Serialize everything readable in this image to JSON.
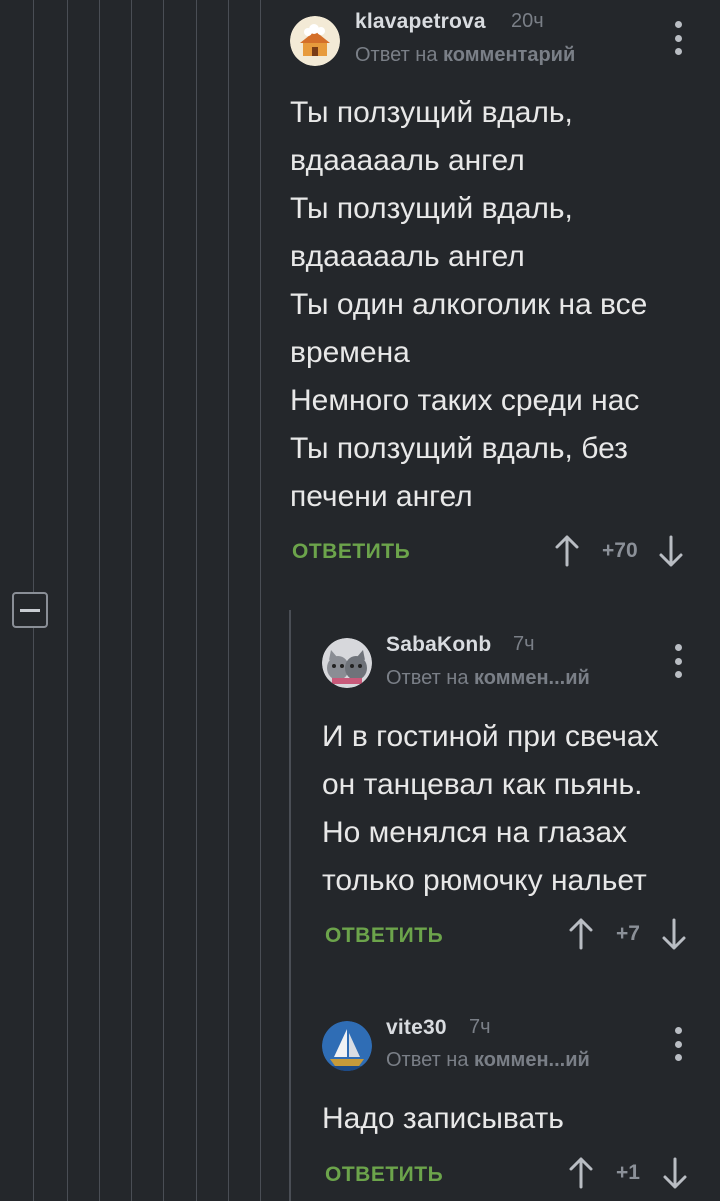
{
  "comments": [
    {
      "username": "klavapetrova",
      "time": "20ч",
      "reply_prefix": "Ответ на",
      "reply_target": "комментарий",
      "text": "Ты ползущий вдаль,\nвдаааааль ангел\nТы ползущий вдаль,\nвдаааааль ангел\nТы один алкоголик на все\nвремена\nНемного таких среди нас\nТы ползущий вдаль, без\nпечени ангел",
      "reply_label": "ОТВЕТИТЬ",
      "score": "+70"
    },
    {
      "username": "SabaKonb",
      "time": "7ч",
      "reply_prefix": "Ответ на",
      "reply_target": "коммен...ий",
      "text": "И в гостиной при свечах\nон танцевал как пьянь.\nНо менялся на глазах\nтолько рюмочку нальет",
      "reply_label": "ОТВЕТИТЬ",
      "score": "+7"
    },
    {
      "username": "vite30",
      "time": "7ч",
      "reply_prefix": "Ответ на",
      "reply_target": "коммен...ий",
      "text": "Надо записывать",
      "reply_label": "ОТВЕТИТЬ",
      "score": "+1"
    }
  ],
  "icons": {
    "avatar_1": "house-avatar",
    "avatar_2": "cats-avatar",
    "avatar_3": "sailboat-avatar",
    "more": "kebab-menu-icon",
    "upvote": "arrow-up-icon",
    "downvote": "arrow-down-icon",
    "collapse": "minus-icon"
  },
  "colors": {
    "background": "#24272b",
    "accent_green": "#6ca44b",
    "muted": "#7a7f87"
  }
}
